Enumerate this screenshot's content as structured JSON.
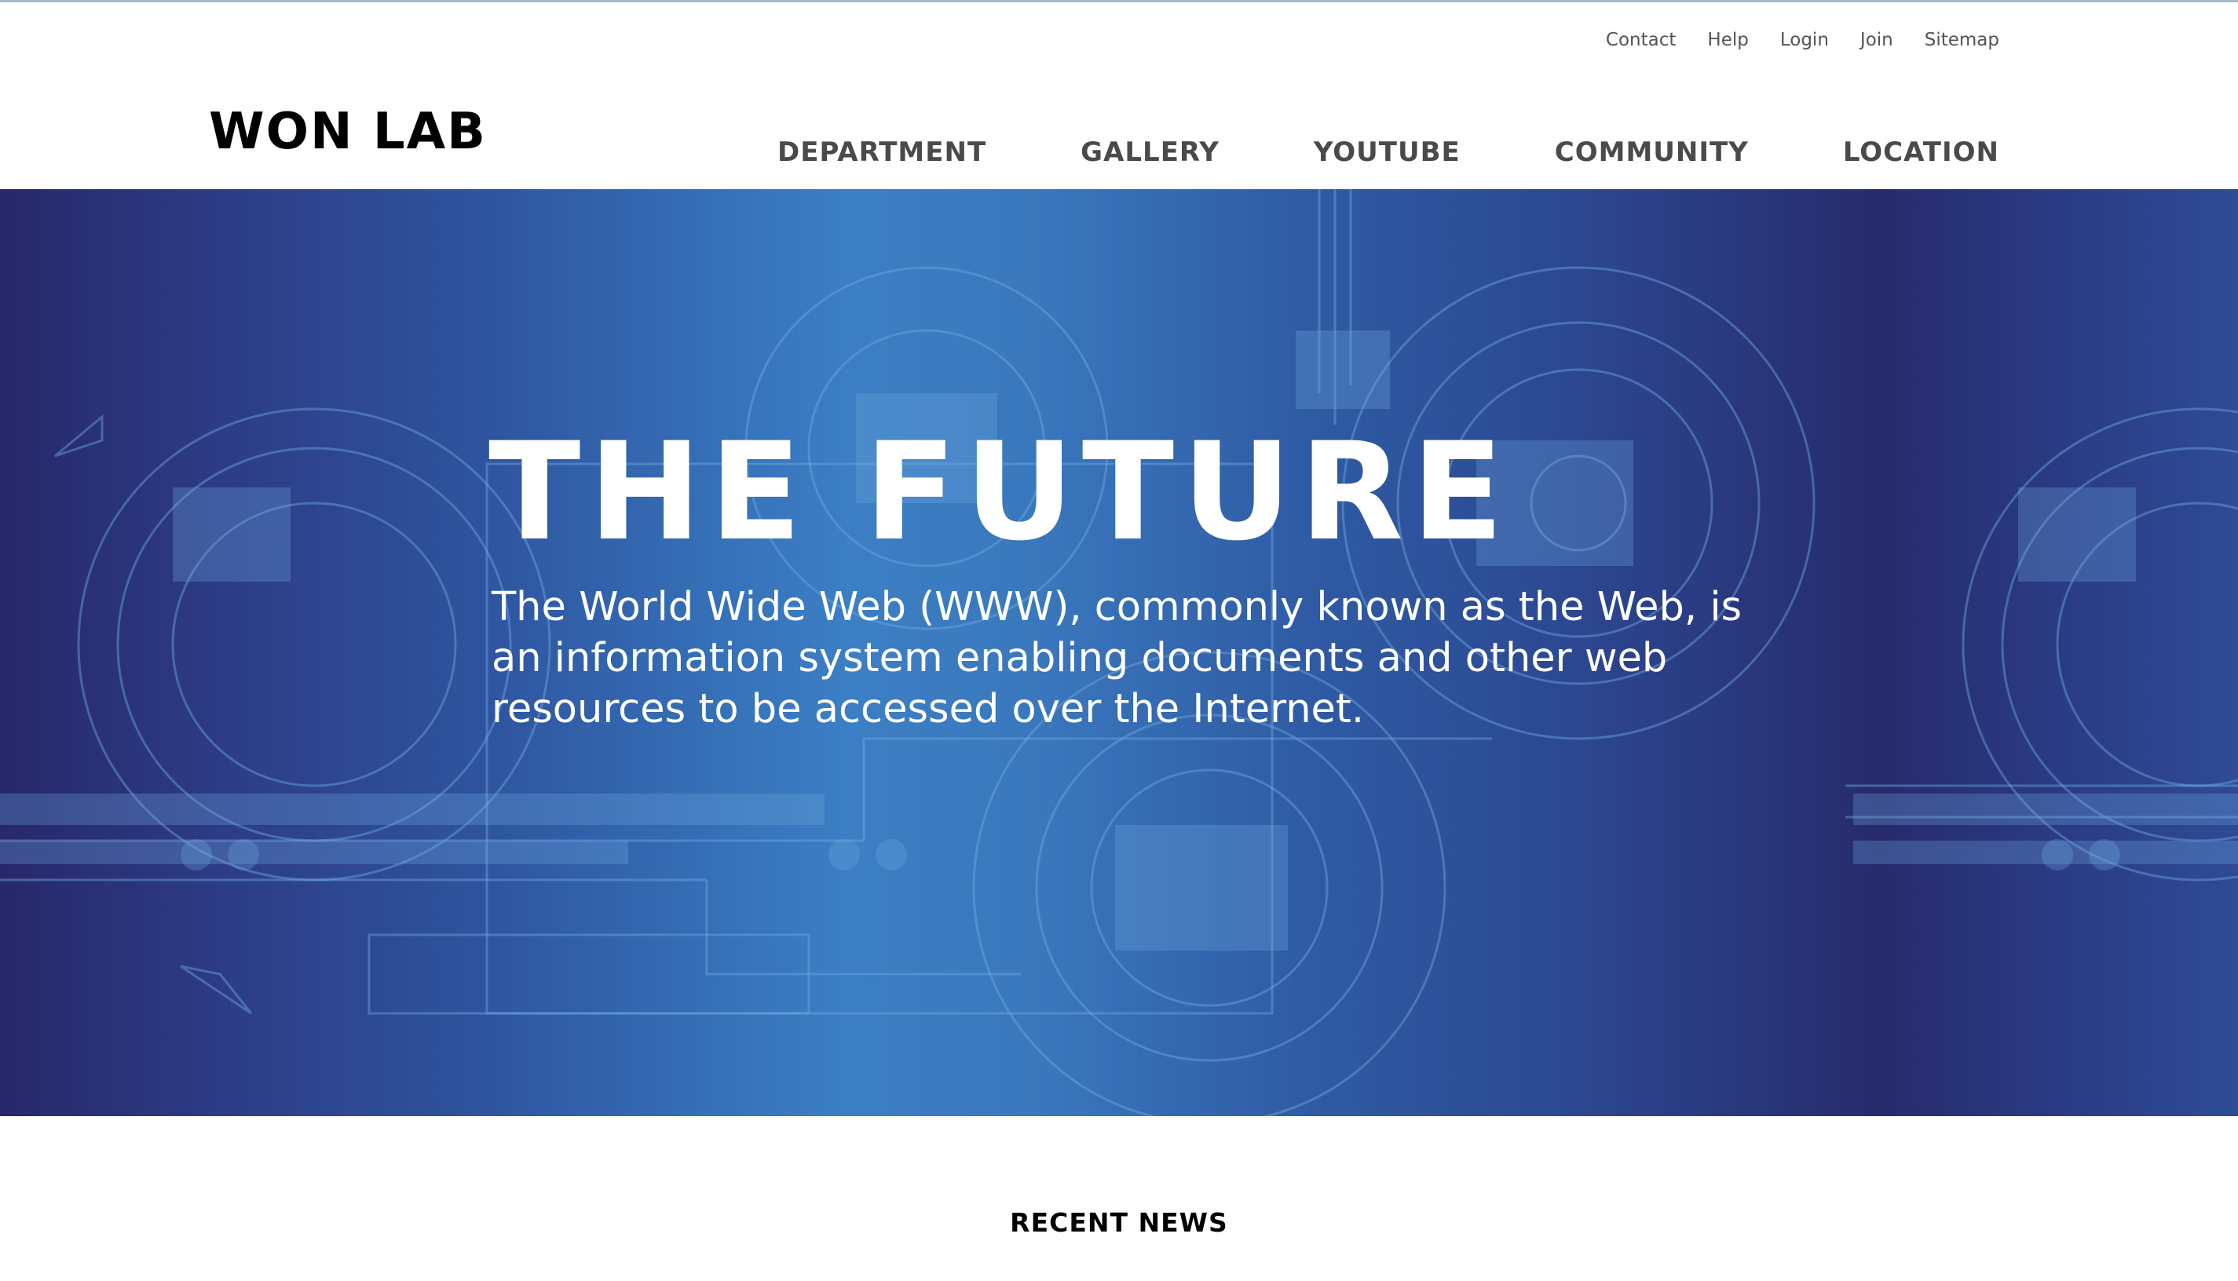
{
  "header": {
    "utility_links": [
      {
        "label": "Contact"
      },
      {
        "label": "Help"
      },
      {
        "label": "Login"
      },
      {
        "label": "Join"
      },
      {
        "label": "Sitemap"
      }
    ],
    "logo": "WON LAB",
    "nav": [
      {
        "label": "DEPARTMENT"
      },
      {
        "label": "GALLERY"
      },
      {
        "label": "YOUTUBE"
      },
      {
        "label": "COMMUNITY"
      },
      {
        "label": "LOCATION"
      }
    ]
  },
  "hero": {
    "title": "THE FUTURE",
    "description": "The World Wide Web (WWW), commonly known as the Web, is an information system enabling documents and other web resources to be accessed over the Internet."
  },
  "news": {
    "heading": "RECENT NEWS"
  },
  "colors": {
    "hero_dark": "#27286a",
    "hero_light": "#3c7fc4",
    "text_dark": "#000000",
    "nav_text": "#4a4a4a"
  }
}
